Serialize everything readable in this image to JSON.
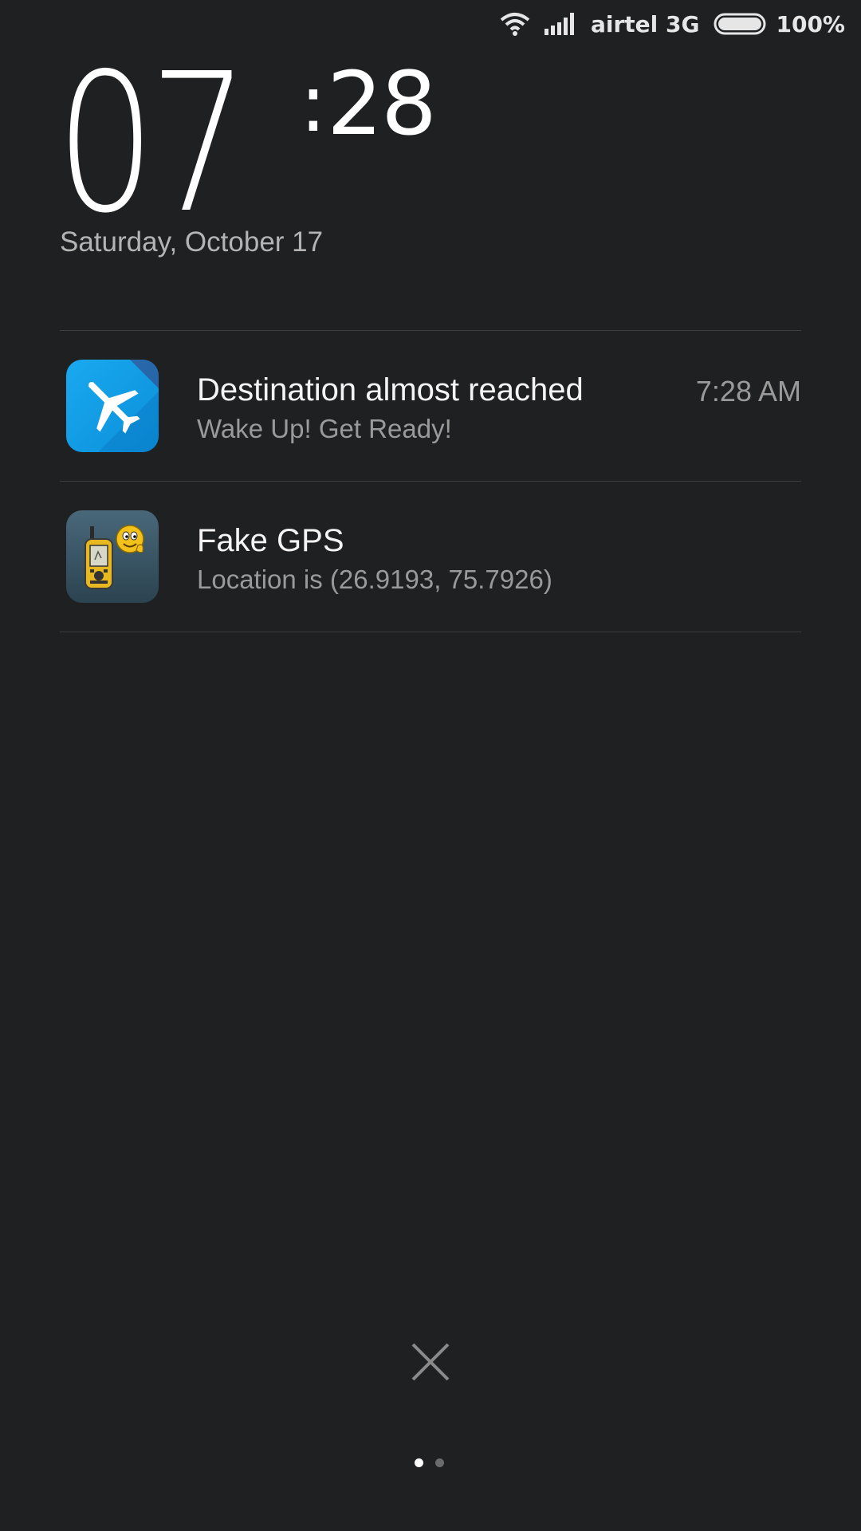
{
  "status_bar": {
    "carrier": "airtel 3G",
    "battery": "100%",
    "wifi_icon": "wifi-icon",
    "signal_icon": "signal-icon",
    "battery_icon": "battery-icon"
  },
  "lockscreen": {
    "clock_hours": "07",
    "clock_colon": ":",
    "clock_minutes": "28",
    "date": "Saturday, October 17"
  },
  "notifications": [
    {
      "icon": "airplane-app-icon",
      "title": "Destination almost reached",
      "text": "Wake Up! Get Ready!",
      "time": "7:28 AM",
      "icon_color": "#0b9ee8"
    },
    {
      "icon": "fake-gps-app-icon",
      "title": "Fake GPS",
      "text": "Location is (26.9193, 75.7926)",
      "time": ""
    }
  ],
  "controls": {
    "clear_icon": "close-icon",
    "pages": 2,
    "active_page": 1
  },
  "colors": {
    "background": "#1f2022",
    "divider": "#3c3d40",
    "secondary_text": "#9a9a9a"
  }
}
